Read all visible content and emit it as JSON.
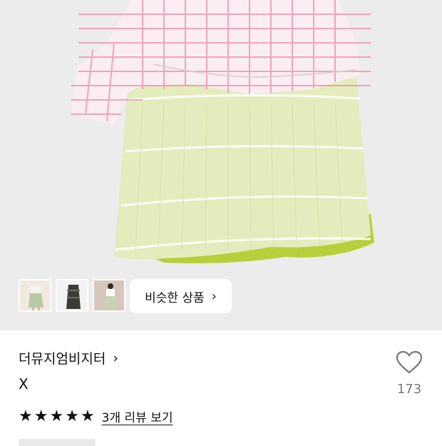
{
  "product": {
    "brand": "더뮤지엄비지터",
    "name": "X",
    "like_count": "173",
    "rating": 5,
    "review_link": "3개 리뷰 보기",
    "similar_label": "비슷한 상품"
  },
  "thumbnails": [
    {
      "desc": "model-green-skirt"
    },
    {
      "desc": "flatlay-dark-skirt"
    },
    {
      "desc": "model-white-top-green-skirt"
    }
  ],
  "icons": {
    "chevron": "›",
    "heart": "heart-outline-icon",
    "star": "★"
  }
}
